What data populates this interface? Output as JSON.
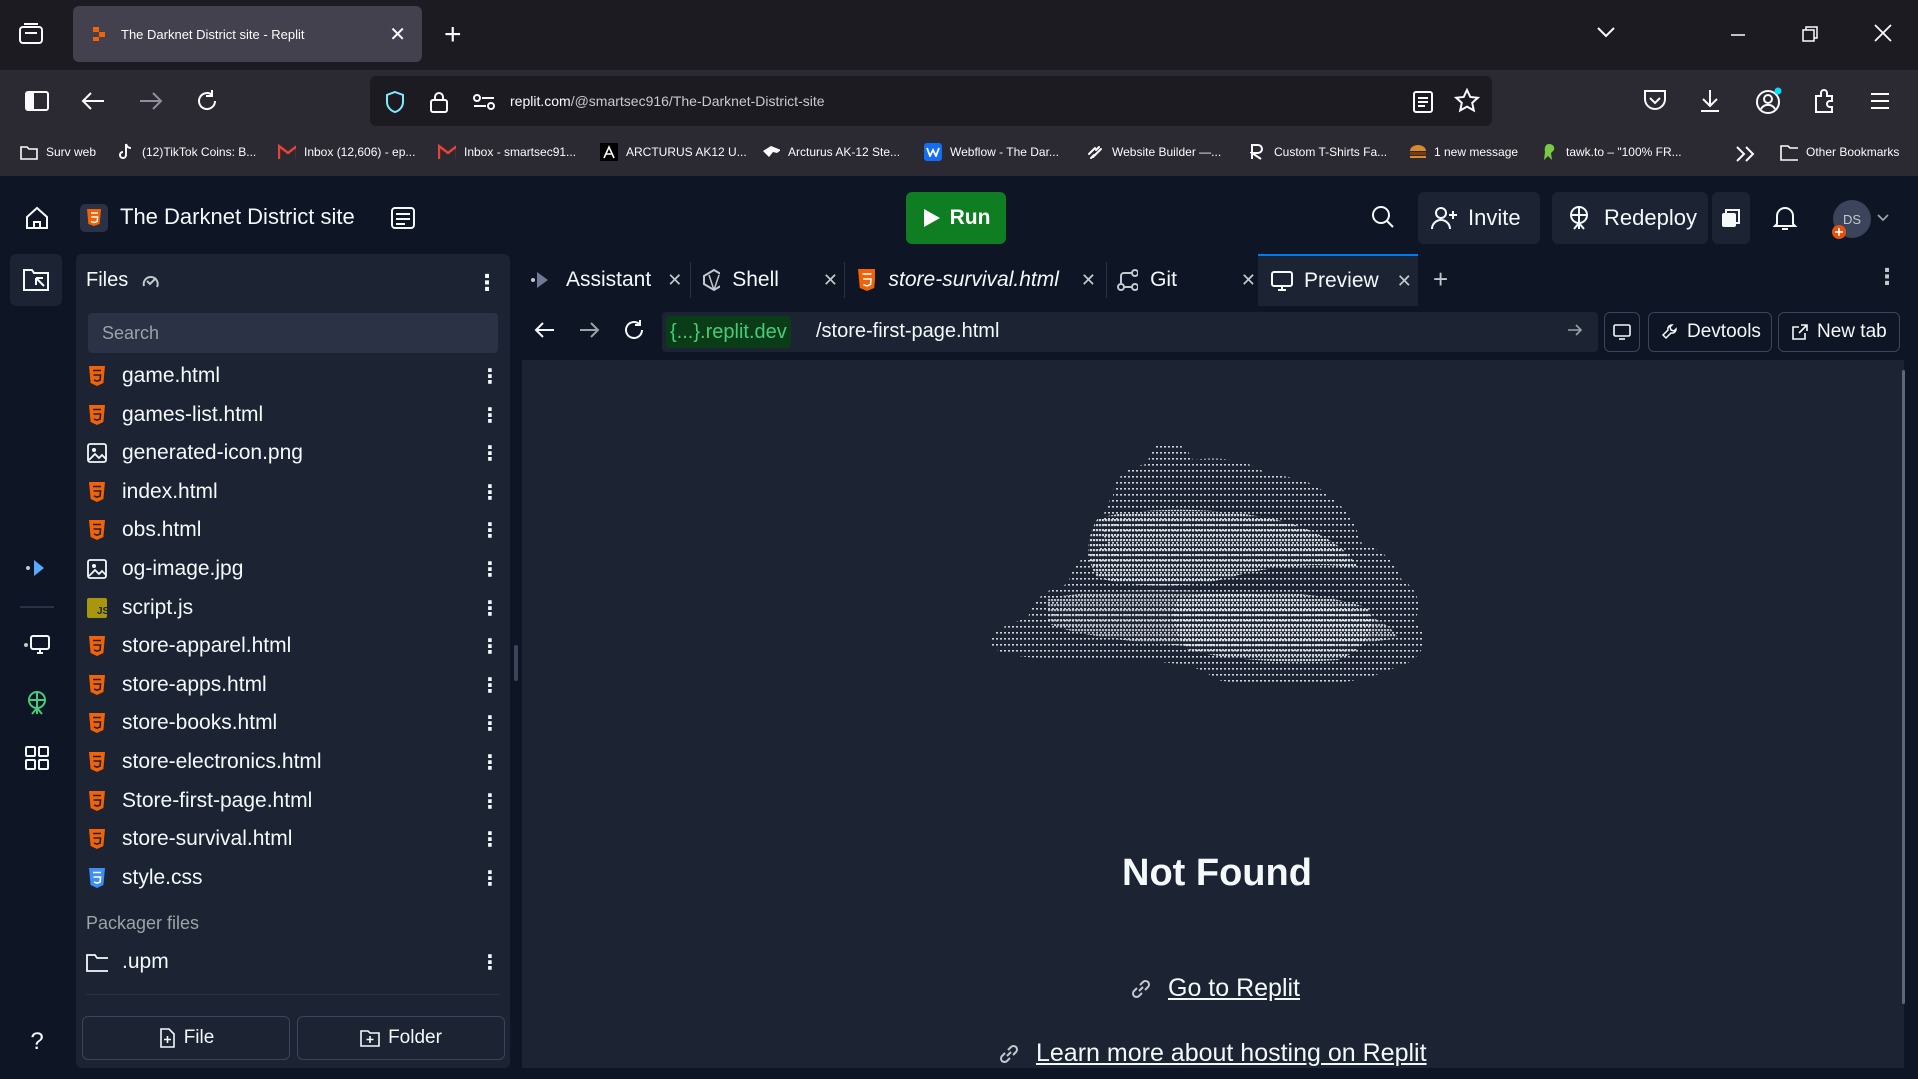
{
  "browser": {
    "tab_title": "The Darknet District site - Replit",
    "url_host": "replit.com",
    "url_path": "/@smartsec916/The-Darknet-District-site",
    "bookmarks": [
      {
        "label": "Surv web",
        "icon": "folder-icon"
      },
      {
        "label": "(12)TikTok Coins: B...",
        "icon": "tiktok-icon"
      },
      {
        "label": "Inbox (12,606) - ep...",
        "icon": "gmail-icon"
      },
      {
        "label": "Inbox - smartsec91...",
        "icon": "gmail-icon"
      },
      {
        "label": "ARCTURUS AK12 U...",
        "icon": "arcturus-icon"
      },
      {
        "label": "Arcturus AK-12 Ste...",
        "icon": "gun-icon"
      },
      {
        "label": "Webflow - The Dar...",
        "icon": "webflow-icon"
      },
      {
        "label": "Website Builder —...",
        "icon": "squarespace-icon"
      },
      {
        "label": "Custom T-Shirts Fa...",
        "icon": "r-icon"
      },
      {
        "label": "1 new message",
        "icon": "burger-icon"
      },
      {
        "label": "tawk.to – \"100% FR...",
        "icon": "parrot-icon"
      }
    ],
    "other_bookmarks": "Other Bookmarks"
  },
  "replit": {
    "project_title": "The Darknet District site",
    "run_label": "Run",
    "invite_label": "Invite",
    "redeploy_label": "Redeploy",
    "avatar_initials": "DS",
    "files": {
      "title": "Files",
      "search_placeholder": "Search",
      "items": [
        {
          "name": "game.html",
          "type": "html"
        },
        {
          "name": "games-list.html",
          "type": "html"
        },
        {
          "name": "generated-icon.png",
          "type": "image"
        },
        {
          "name": "index.html",
          "type": "html"
        },
        {
          "name": "obs.html",
          "type": "html"
        },
        {
          "name": "og-image.jpg",
          "type": "image"
        },
        {
          "name": "script.js",
          "type": "js"
        },
        {
          "name": "store-apparel.html",
          "type": "html"
        },
        {
          "name": "store-apps.html",
          "type": "html"
        },
        {
          "name": "store-books.html",
          "type": "html"
        },
        {
          "name": "store-electronics.html",
          "type": "html"
        },
        {
          "name": "Store-first-page.html",
          "type": "html"
        },
        {
          "name": "store-survival.html",
          "type": "html"
        },
        {
          "name": "style.css",
          "type": "css"
        }
      ],
      "packager_label": "Packager files",
      "packager_items": [
        {
          "name": ".upm",
          "type": "folder"
        }
      ],
      "new_file_label": "File",
      "new_folder_label": "Folder"
    },
    "tabs": [
      {
        "label": "Assistant",
        "icon": "assistant-icon",
        "italic": false,
        "active": false
      },
      {
        "label": "Shell",
        "icon": "shell-icon",
        "italic": false,
        "active": false
      },
      {
        "label": "store-survival.html",
        "icon": "html-icon",
        "italic": true,
        "active": false
      },
      {
        "label": "Git",
        "icon": "git-icon",
        "italic": false,
        "active": false
      },
      {
        "label": "Preview",
        "icon": "monitor-icon",
        "italic": false,
        "active": true
      }
    ],
    "preview": {
      "domain_token": "{...}",
      "domain_suffix": ".replit.dev",
      "path": "/store-first-page.html",
      "devtools_label": "Devtools",
      "newtab_label": "New tab",
      "not_found": "Not Found",
      "go_to_replit": "Go to Replit",
      "learn_more": "Learn more about hosting on Replit"
    }
  }
}
